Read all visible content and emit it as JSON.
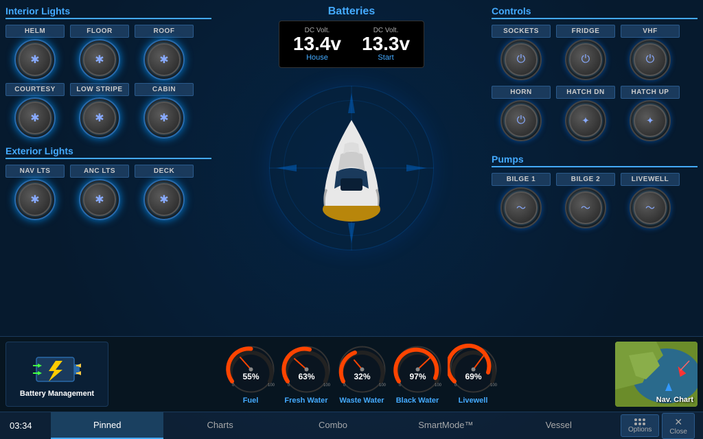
{
  "header": {
    "batteries_title": "Batteries",
    "house_label": "House",
    "start_label": "Start",
    "house_dc_label": "DC Volt.",
    "start_dc_label": "DC Volt.",
    "house_value": "13.4v",
    "start_value": "13.3v"
  },
  "interior_lights": {
    "title": "Interior Lights",
    "buttons": [
      "HELM",
      "FLOOR",
      "ROOF",
      "COURTESY",
      "LOW STRIPE",
      "CABIN"
    ]
  },
  "exterior_lights": {
    "title": "Exterior Lights",
    "buttons": [
      "NAV LTS",
      "ANC LTS",
      "DECK"
    ]
  },
  "controls": {
    "title": "Controls",
    "buttons": [
      "SOCKETS",
      "FRIDGE",
      "VHF",
      "HORN",
      "HATCH DN",
      "HATCH UP"
    ]
  },
  "pumps": {
    "title": "Pumps",
    "buttons": [
      "BILGE 1",
      "BILGE 2",
      "LIVEWELL"
    ]
  },
  "battery_management": {
    "label": "Battery Management"
  },
  "gauges": [
    {
      "id": "fuel",
      "label": "Fuel",
      "value": 55,
      "color": "#ff4400",
      "text": "55%"
    },
    {
      "id": "fresh_water",
      "label": "Fresh Water",
      "value": 63,
      "color": "#ff4400",
      "text": "63%"
    },
    {
      "id": "waste_water",
      "label": "Waste Water",
      "value": 32,
      "color": "#ff4400",
      "text": "32%"
    },
    {
      "id": "black_water",
      "label": "Black Water",
      "value": 97,
      "color": "#ff4400",
      "text": "97%"
    },
    {
      "id": "livewell",
      "label": "Livewell",
      "value": 69,
      "color": "#ff4400",
      "text": "69%"
    }
  ],
  "nav_chart": {
    "label": "Nav. Chart"
  },
  "taskbar": {
    "time": "03:34",
    "tabs": [
      "Pinned",
      "Charts",
      "Combo",
      "SmartMode™",
      "Vessel"
    ],
    "active_tab": 0,
    "options_label": "Options",
    "close_label": "Close"
  }
}
